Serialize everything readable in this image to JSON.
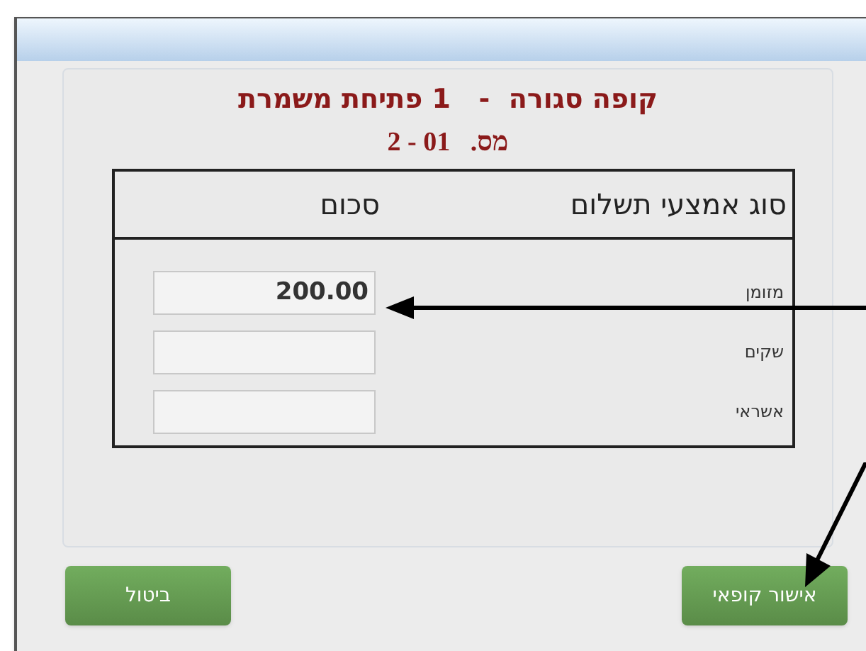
{
  "title": "קופה סגורה  -   1 פתיחת משמרת",
  "subtitle": "מס.   01 - 2",
  "table": {
    "columns": [
      "סוג אמצעי תשלום",
      "סכום"
    ],
    "rows": [
      {
        "label": "מזומן",
        "value": "200.00"
      },
      {
        "label": "שקים"
      },
      {
        "label": "אשראי"
      }
    ]
  },
  "buttons": [
    "אישור קופאי",
    "ביטול"
  ]
}
